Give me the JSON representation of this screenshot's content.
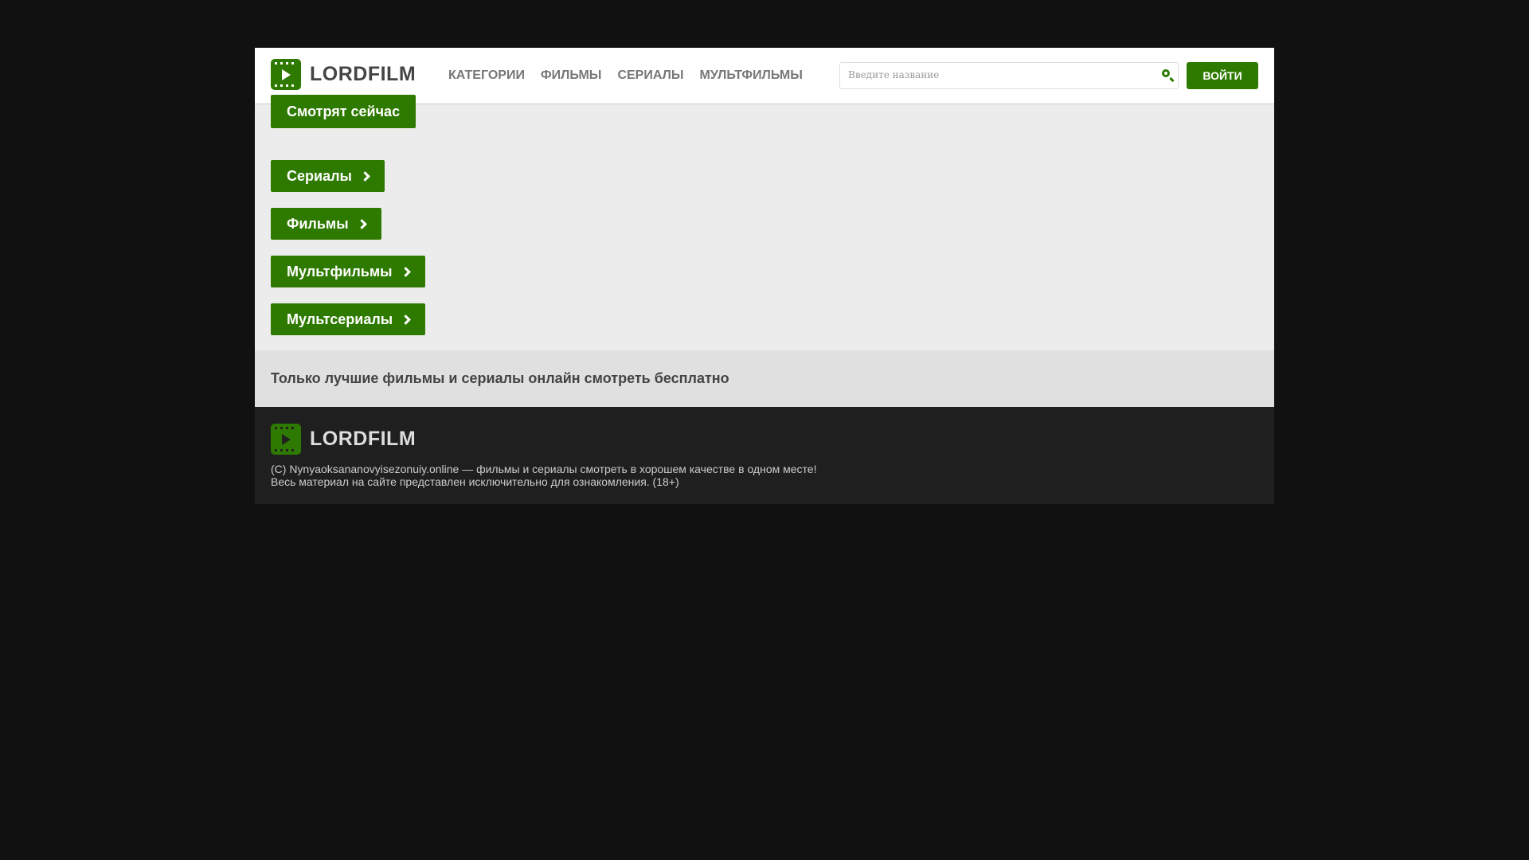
{
  "header": {
    "logo_text": "LORDFILM",
    "nav": [
      "КАТЕГОРИИ",
      "ФИЛЬМЫ",
      "СЕРИАЛЫ",
      "МУЛЬТФИЛЬМЫ"
    ],
    "search_placeholder": "Введите название",
    "login_label": "ВОЙТИ"
  },
  "main": {
    "watching_now": "Смотрят сейчас",
    "categories": [
      "Сериалы",
      "Фильмы",
      "Мультфильмы",
      "Мультсериалы"
    ]
  },
  "tagline": "Только лучшие фильмы и сериалы онлайн смотреть бесплатно",
  "footer": {
    "logo_text": "LORDFILM",
    "line1": "(C) Nynyaoksananovyisezonuiy.online — фильмы и сериалы смотреть в хорошем качестве в одном месте!",
    "line2": "Весь материал на сайте представлен исключительно для ознакомления. (18+)"
  },
  "colors": {
    "accent": "#2e7a00"
  }
}
